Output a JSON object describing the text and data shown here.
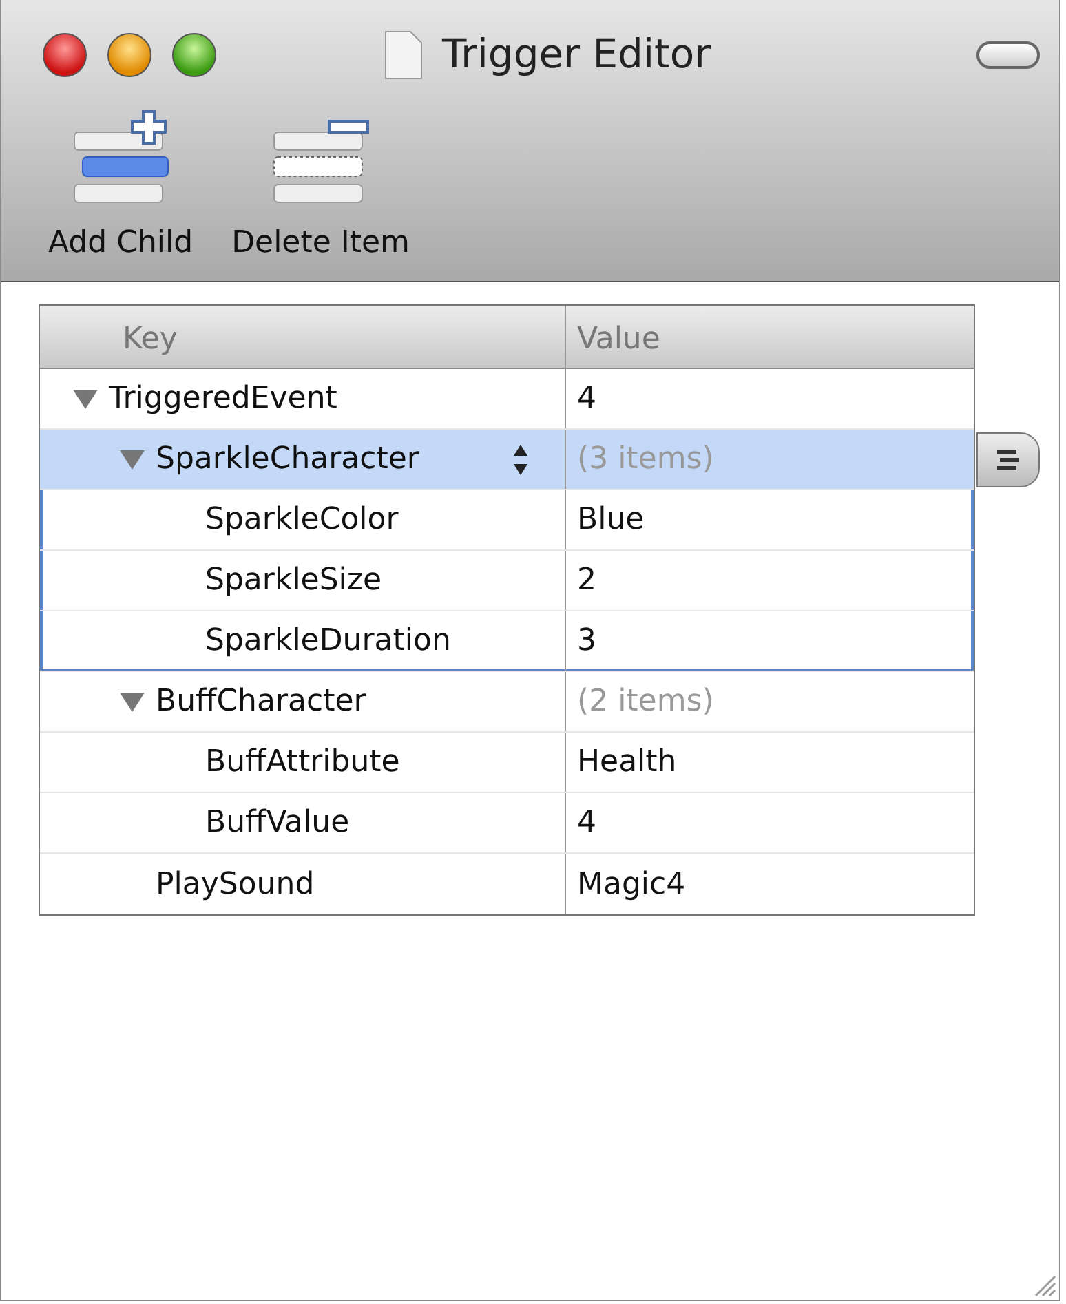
{
  "window": {
    "title": "Trigger Editor"
  },
  "toolbar": [
    {
      "label": "Add Child",
      "kind": "add"
    },
    {
      "label": "Delete Item",
      "kind": "delete"
    }
  ],
  "table": {
    "columns": [
      "Key",
      "Value"
    ],
    "rows": [
      {
        "key": "TriggeredEvent",
        "value": "4",
        "dimmed": false,
        "expanded": true,
        "selected": false,
        "children": [
          {
            "key": "SparkleCharacter",
            "value": "(3 items)",
            "dimmed": true,
            "expanded": true,
            "selected": true,
            "children": [
              {
                "key": "SparkleColor",
                "value": "Blue",
                "dimmed": false,
                "selected": false
              },
              {
                "key": "SparkleSize",
                "value": "2",
                "dimmed": false,
                "selected": false
              },
              {
                "key": "SparkleDuration",
                "value": "3",
                "dimmed": false,
                "selected": false
              }
            ]
          },
          {
            "key": "BuffCharacter",
            "value": "(2 items)",
            "dimmed": true,
            "expanded": true,
            "selected": false,
            "children": [
              {
                "key": "BuffAttribute",
                "value": "Health",
                "dimmed": false,
                "selected": false
              },
              {
                "key": "BuffValue",
                "value": "4",
                "dimmed": false,
                "selected": false
              }
            ]
          },
          {
            "key": "PlaySound",
            "value": "Magic4",
            "dimmed": false,
            "selected": false
          }
        ]
      }
    ]
  }
}
